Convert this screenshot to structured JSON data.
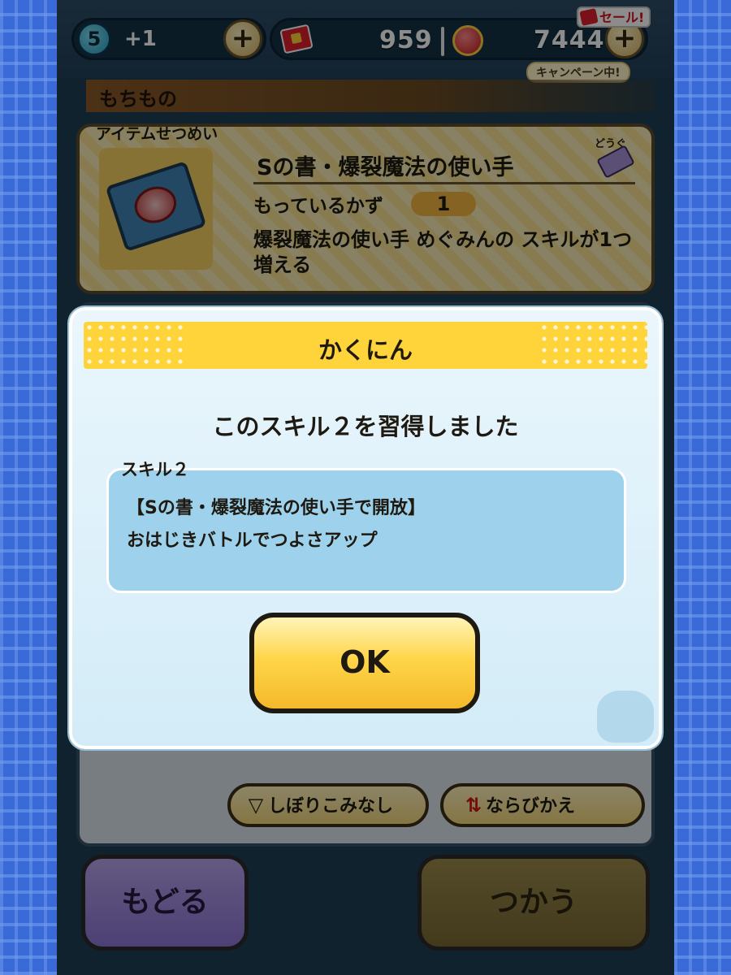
{
  "top_bar": {
    "stamina_level": "5",
    "stamina_plus": "+1",
    "plus_label": "+",
    "tickets": "959",
    "coins": "7444",
    "sale_badge": "セール!",
    "campaign_badge": "キャンペーン中!"
  },
  "header": {
    "title": "もちもの"
  },
  "item_card": {
    "label": "アイテムせつめい",
    "name": "Sの書・爆裂魔法の使い手",
    "category_tag": "どうぐ",
    "count_label": "もっているかず",
    "count": "1",
    "description": "爆裂魔法の使い手 めぐみんの スキルが1つ増える"
  },
  "controls": {
    "filter_label": "しぼりこみなし",
    "sort_label": "ならびかえ",
    "back_label": "もどる",
    "use_label": "つかう"
  },
  "modal": {
    "title": "かくにん",
    "message": "このスキル２を習得しました",
    "skill_label": "スキル２",
    "skill_line1": "【Sの書・爆裂魔法の使い手で開放】",
    "skill_line2": "おはじきバトルでつよさアップ",
    "ok_label": "OK"
  },
  "colors": {
    "modal_title_bar": "#ffd43a",
    "skill_box": "#9ed2ec",
    "ok_button": "#ffd54a",
    "back_button": "#8c75d6"
  }
}
